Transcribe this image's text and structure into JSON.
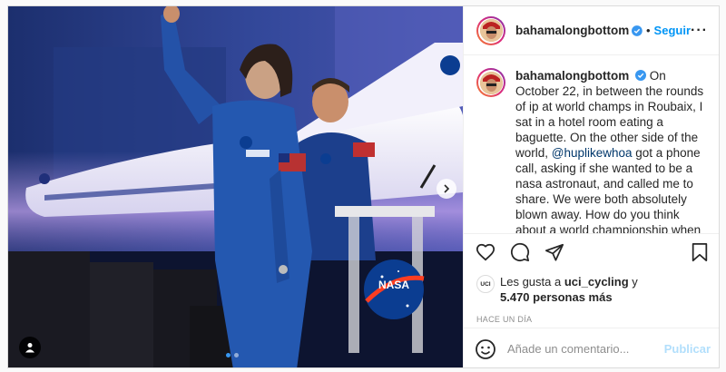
{
  "post": {
    "username": "bahamalongbottom",
    "follow_label": "Seguir",
    "separator": "•",
    "more_label": "···",
    "caption": {
      "username": "bahamalongbottom",
      "text_before_mention": "On October 22, in between the rounds of ip at world champs in Roubaix, I sat in a hotel room eating a baguette. On the other side of the world, ",
      "mention": "@huplikewhoa",
      "text_after_mention": " got a phone call, asking if she wanted to be a nasa astronaut, and called me to share. We were both absolutely blown away. How do you think about a world championship when your partner is going to space? 😲 Sitting in a stairwell in my rainbow jersey we talked about the"
    },
    "likes": {
      "liker_avatar_text": "UCI",
      "prefix": "Les gusta a",
      "liker": "uci_cycling",
      "connector": "y",
      "count_text": "5.470 personas más"
    },
    "time": "HACE UN DÍA",
    "comment": {
      "placeholder": "Añade un comentario...",
      "value": "",
      "post_label": "Publicar"
    }
  },
  "media": {
    "logo_text": "NASA",
    "dots_total": 2,
    "dots_active_index": 0
  },
  "colors": {
    "accent": "#0095f6",
    "mention": "#00376b",
    "post_disabled": "#b2dffc",
    "verified": "#3897f0"
  },
  "icons": [
    "verified-icon",
    "more-icon",
    "heart-icon",
    "comment-icon",
    "share-icon",
    "bookmark-icon",
    "emoji-icon",
    "chevron-right-icon",
    "user-tag-icon"
  ]
}
